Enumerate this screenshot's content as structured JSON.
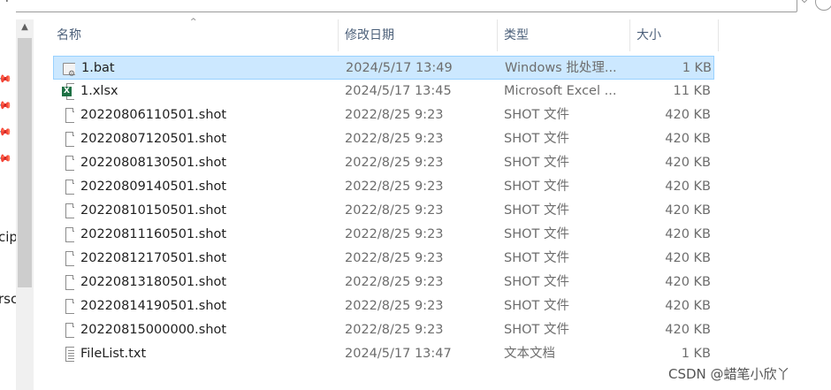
{
  "address_bar": {
    "text": "↑",
    "dropdown_glyph": "⌵"
  },
  "left_pane": {
    "fragments": [
      "cip",
      "rsc"
    ]
  },
  "columns": {
    "name": "名称",
    "date_modified": "修改日期",
    "type": "类型",
    "size": "大小"
  },
  "files": [
    {
      "icon": "bat-file-icon",
      "name": "1.bat",
      "date": "2024/5/17 13:49",
      "type": "Windows 批处理...",
      "size": "1 KB",
      "selected": true
    },
    {
      "icon": "excel-file-icon",
      "name": "1.xlsx",
      "date": "2024/5/17 13:45",
      "type": "Microsoft Excel ...",
      "size": "11 KB",
      "selected": false
    },
    {
      "icon": "file-icon",
      "name": "20220806110501.shot",
      "date": "2022/8/25 9:23",
      "type": "SHOT 文件",
      "size": "420 KB",
      "selected": false
    },
    {
      "icon": "file-icon",
      "name": "20220807120501.shot",
      "date": "2022/8/25 9:23",
      "type": "SHOT 文件",
      "size": "420 KB",
      "selected": false
    },
    {
      "icon": "file-icon",
      "name": "20220808130501.shot",
      "date": "2022/8/25 9:23",
      "type": "SHOT 文件",
      "size": "420 KB",
      "selected": false
    },
    {
      "icon": "file-icon",
      "name": "20220809140501.shot",
      "date": "2022/8/25 9:23",
      "type": "SHOT 文件",
      "size": "420 KB",
      "selected": false
    },
    {
      "icon": "file-icon",
      "name": "20220810150501.shot",
      "date": "2022/8/25 9:23",
      "type": "SHOT 文件",
      "size": "420 KB",
      "selected": false
    },
    {
      "icon": "file-icon",
      "name": "20220811160501.shot",
      "date": "2022/8/25 9:23",
      "type": "SHOT 文件",
      "size": "420 KB",
      "selected": false
    },
    {
      "icon": "file-icon",
      "name": "20220812170501.shot",
      "date": "2022/8/25 9:23",
      "type": "SHOT 文件",
      "size": "420 KB",
      "selected": false
    },
    {
      "icon": "file-icon",
      "name": "20220813180501.shot",
      "date": "2022/8/25 9:23",
      "type": "SHOT 文件",
      "size": "420 KB",
      "selected": false
    },
    {
      "icon": "file-icon",
      "name": "20220814190501.shot",
      "date": "2022/8/25 9:23",
      "type": "SHOT 文件",
      "size": "420 KB",
      "selected": false
    },
    {
      "icon": "file-icon",
      "name": "20220815000000.shot",
      "date": "2022/8/25 9:23",
      "type": "SHOT 文件",
      "size": "420 KB",
      "selected": false
    },
    {
      "icon": "text-file-icon",
      "name": "FileList.txt",
      "date": "2024/5/17 13:47",
      "type": "文本文档",
      "size": "1 KB",
      "selected": false
    }
  ],
  "watermark": "CSDN @蜡笔小欣丫",
  "colors": {
    "selection_bg": "#cce8ff",
    "selection_border": "#99d1ff",
    "header_text": "#4c607a",
    "excel_green": "#1d7044"
  }
}
